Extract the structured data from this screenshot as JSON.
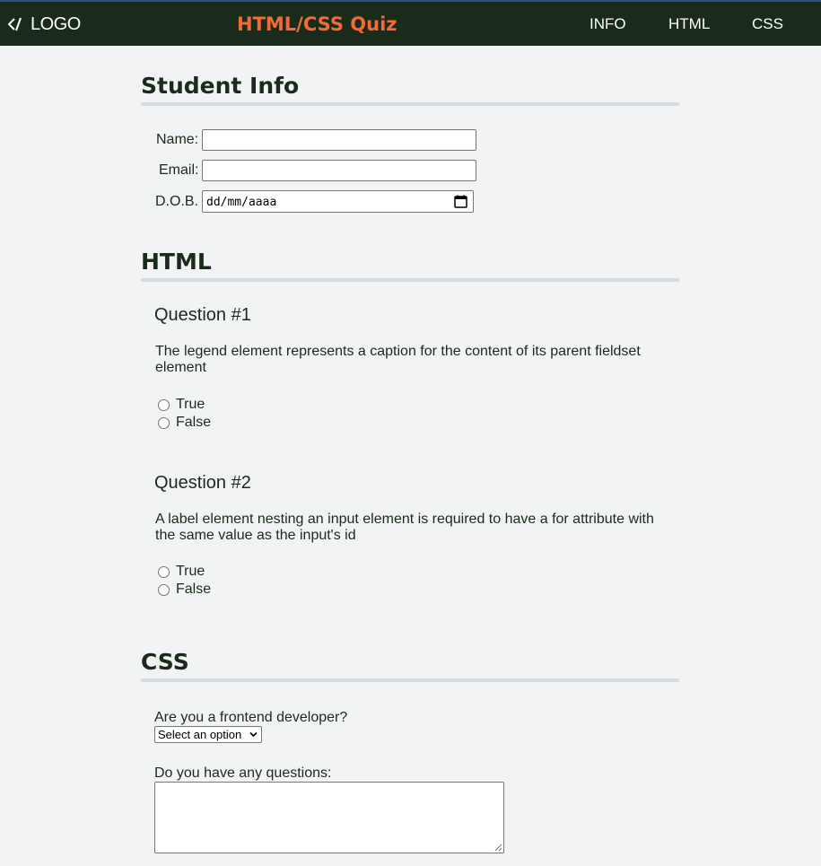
{
  "header": {
    "logo_text": "LOGO",
    "title": "HTML/CSS Quiz",
    "nav": [
      "INFO",
      "HTML",
      "CSS"
    ]
  },
  "student_info": {
    "heading": "Student Info",
    "name_label": "Name:",
    "name_value": "",
    "email_label": "Email:",
    "email_value": "",
    "dob_label": "D.O.B.",
    "dob_placeholder": "dd/mm/aaaa"
  },
  "html_section": {
    "heading": "HTML",
    "questions": [
      {
        "title": "Question #1",
        "text": "The legend element represents a caption for the content of its parent fieldset element",
        "options": [
          "True",
          "False"
        ]
      },
      {
        "title": "Question #2",
        "text": "A label element nesting an input element is required to have a for attribute with the same value as the input's id",
        "options": [
          "True",
          "False"
        ]
      }
    ]
  },
  "css_section": {
    "heading": "CSS",
    "frontend_label": "Are you a frontend developer?",
    "select_value": "Select an option",
    "questions_label": "Do you have any questions:",
    "questions_value": ""
  },
  "colors": {
    "header_bg": "#1b2b1b",
    "title_accent": "#f36a35",
    "page_bg": "#f1f3f4"
  }
}
